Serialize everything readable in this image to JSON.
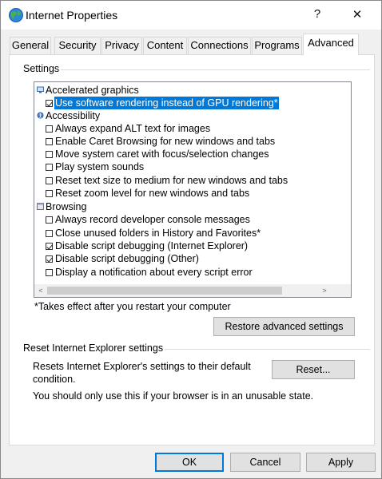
{
  "window": {
    "title": "Internet Properties",
    "help_glyph": "?",
    "close_glyph": "✕"
  },
  "tabs": [
    {
      "label": "General"
    },
    {
      "label": "Security"
    },
    {
      "label": "Privacy"
    },
    {
      "label": "Content"
    },
    {
      "label": "Connections"
    },
    {
      "label": "Programs"
    },
    {
      "label": "Advanced"
    }
  ],
  "active_tab": "Advanced",
  "settings_group": {
    "label": "Settings",
    "items": [
      {
        "type": "category",
        "label": "Accelerated graphics",
        "icon": "monitor-icon"
      },
      {
        "type": "checkbox",
        "label": "Use software rendering instead of GPU rendering*",
        "checked": true,
        "selected": true
      },
      {
        "type": "category",
        "label": "Accessibility",
        "icon": "accessibility-icon"
      },
      {
        "type": "checkbox",
        "label": "Always expand ALT text for images",
        "checked": false
      },
      {
        "type": "checkbox",
        "label": "Enable Caret Browsing for new windows and tabs",
        "checked": false
      },
      {
        "type": "checkbox",
        "label": "Move system caret with focus/selection changes",
        "checked": false
      },
      {
        "type": "checkbox",
        "label": "Play system sounds",
        "checked": false
      },
      {
        "type": "checkbox",
        "label": "Reset text size to medium for new windows and tabs",
        "checked": false
      },
      {
        "type": "checkbox",
        "label": "Reset zoom level for new windows and tabs",
        "checked": false
      },
      {
        "type": "category",
        "label": "Browsing",
        "icon": "browsing-icon"
      },
      {
        "type": "checkbox",
        "label": "Always record developer console messages",
        "checked": false
      },
      {
        "type": "checkbox",
        "label": "Close unused folders in History and Favorites*",
        "checked": false
      },
      {
        "type": "checkbox",
        "label": "Disable script debugging (Internet Explorer)",
        "checked": true
      },
      {
        "type": "checkbox",
        "label": "Disable script debugging (Other)",
        "checked": true
      },
      {
        "type": "checkbox",
        "label": "Display a notification about every script error",
        "checked": false
      }
    ],
    "footnote": "*Takes effect after you restart your computer",
    "restore_button": "Restore advanced settings"
  },
  "reset_group": {
    "label": "Reset Internet Explorer settings",
    "description": "Resets Internet Explorer's settings to their default condition.",
    "reset_button": "Reset...",
    "warning": "You should only use this if your browser is in an unusable state."
  },
  "footer": {
    "ok": "OK",
    "cancel": "Cancel",
    "apply": "Apply"
  },
  "colors": {
    "selection": "#0078d7",
    "accent_border": "#0078d7"
  }
}
